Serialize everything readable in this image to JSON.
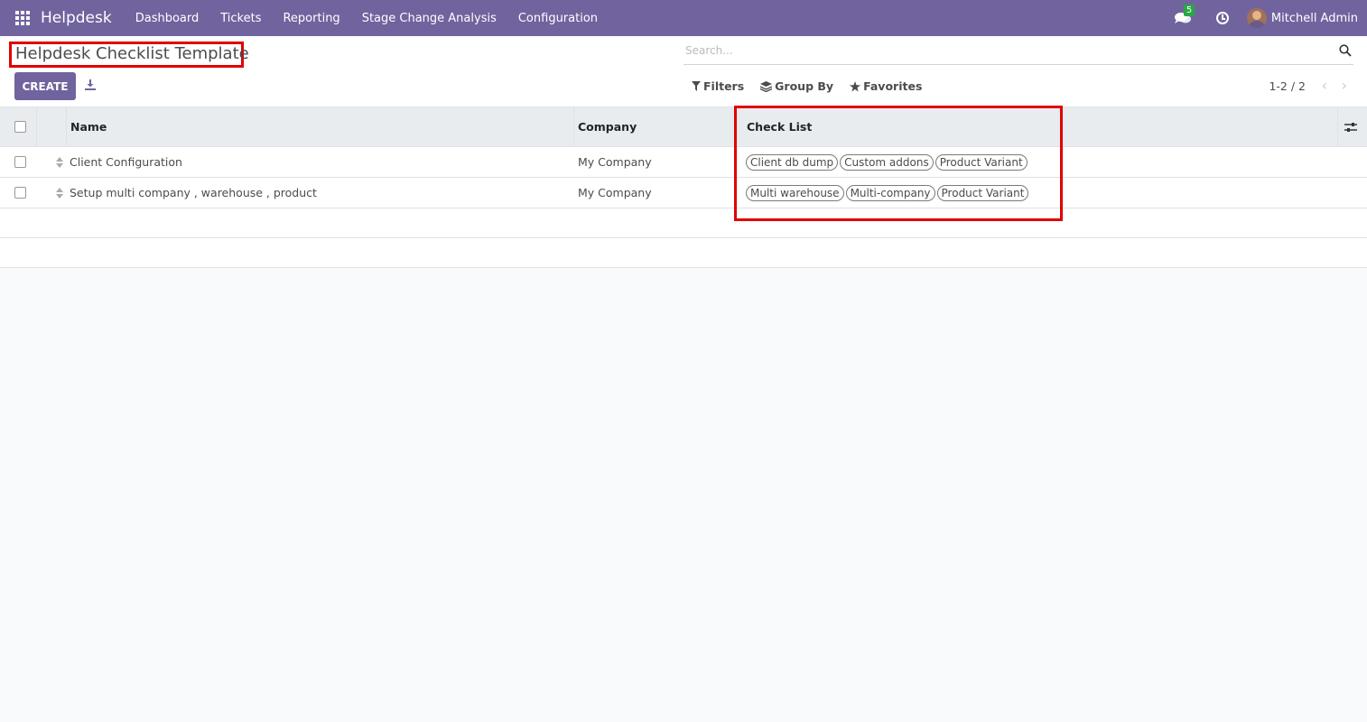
{
  "nav": {
    "app_name": "Helpdesk",
    "menu": [
      "Dashboard",
      "Tickets",
      "Reporting",
      "Stage Change Analysis",
      "Configuration"
    ],
    "messages_count": "5",
    "user_name": "Mitchell Admin",
    "brand_color": "#71639e"
  },
  "control": {
    "title": "Helpdesk Checklist Template",
    "create_label": "CREATE",
    "search_placeholder": "Search...",
    "filters_label": "Filters",
    "group_by_label": "Group By",
    "favorites_label": "Favorites",
    "pager": "1-2 / 2"
  },
  "table": {
    "headers": {
      "name": "Name",
      "company": "Company",
      "checklist": "Check List"
    },
    "rows": [
      {
        "name": "Client Configuration",
        "company": "My Company",
        "tags": [
          "Client db dump",
          "Custom addons",
          "Product Variant"
        ]
      },
      {
        "name": "Setup multi company , warehouse , product",
        "company": "My Company",
        "tags": [
          "Multi warehouse",
          "Multi-company",
          "Product Variant"
        ]
      }
    ]
  },
  "highlight_color": "#e00000"
}
